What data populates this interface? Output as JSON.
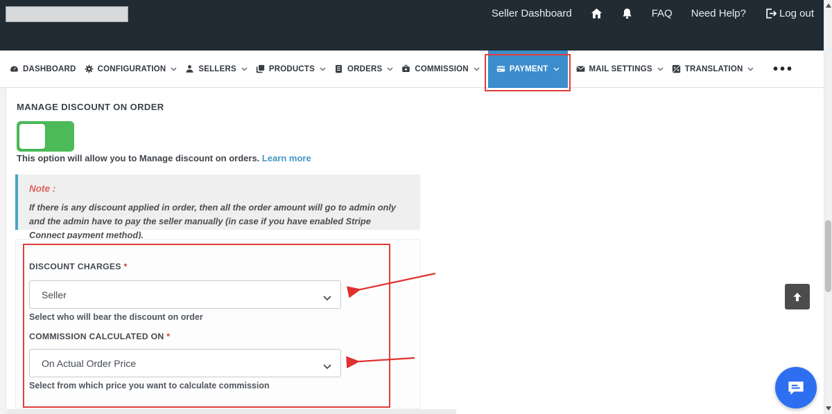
{
  "topbar": {
    "seller_dashboard": "Seller Dashboard",
    "faq": "FAQ",
    "need_help": "Need Help?",
    "log_out": "Log out"
  },
  "nav": {
    "items": [
      {
        "label": "DASHBOARD",
        "icon": "dashboard-icon"
      },
      {
        "label": "CONFIGURATION",
        "icon": "gear-icon"
      },
      {
        "label": "SELLERS",
        "icon": "user-icon"
      },
      {
        "label": "PRODUCTS",
        "icon": "copy-icon"
      },
      {
        "label": "ORDERS",
        "icon": "list-icon"
      },
      {
        "label": "COMMISSION",
        "icon": "money-icon"
      },
      {
        "label": "PAYMENT",
        "icon": "credit-card-icon",
        "active": true
      },
      {
        "label": "MAIL SETTINGS",
        "icon": "envelope-icon"
      },
      {
        "label": "TRANSLATION",
        "icon": "language-icon"
      }
    ],
    "overflow_dots": "•••"
  },
  "content": {
    "section_title": "MANAGE DISCOUNT ON ORDER",
    "toggle_state": "on",
    "description": "This option will allow you to Manage discount on orders.",
    "learn_more_label": "Learn more",
    "note": {
      "title": "Note :",
      "body": "If there is any discount applied in order, then all the order amount will go to admin only and the admin have to pay the seller manually (in case if you have enabled Stripe Connect payment method)."
    },
    "fields": [
      {
        "label": "DISCOUNT CHARGES",
        "required_mark": "*",
        "value": "Seller",
        "help": "Select who will bear the discount on order"
      },
      {
        "label": "COMMISSION CALCULATED ON",
        "required_mark": "*",
        "value": "On Actual Order Price",
        "help": "Select from which price you want to calculate commission"
      }
    ]
  },
  "colors": {
    "topbar_dark": "#212b33",
    "accent_blue": "#3c8dcc",
    "annotation_red": "#e23c3c",
    "toggle_green": "#4cba57",
    "link_blue": "#4596c7",
    "chat_blue": "#2e6ff2"
  }
}
